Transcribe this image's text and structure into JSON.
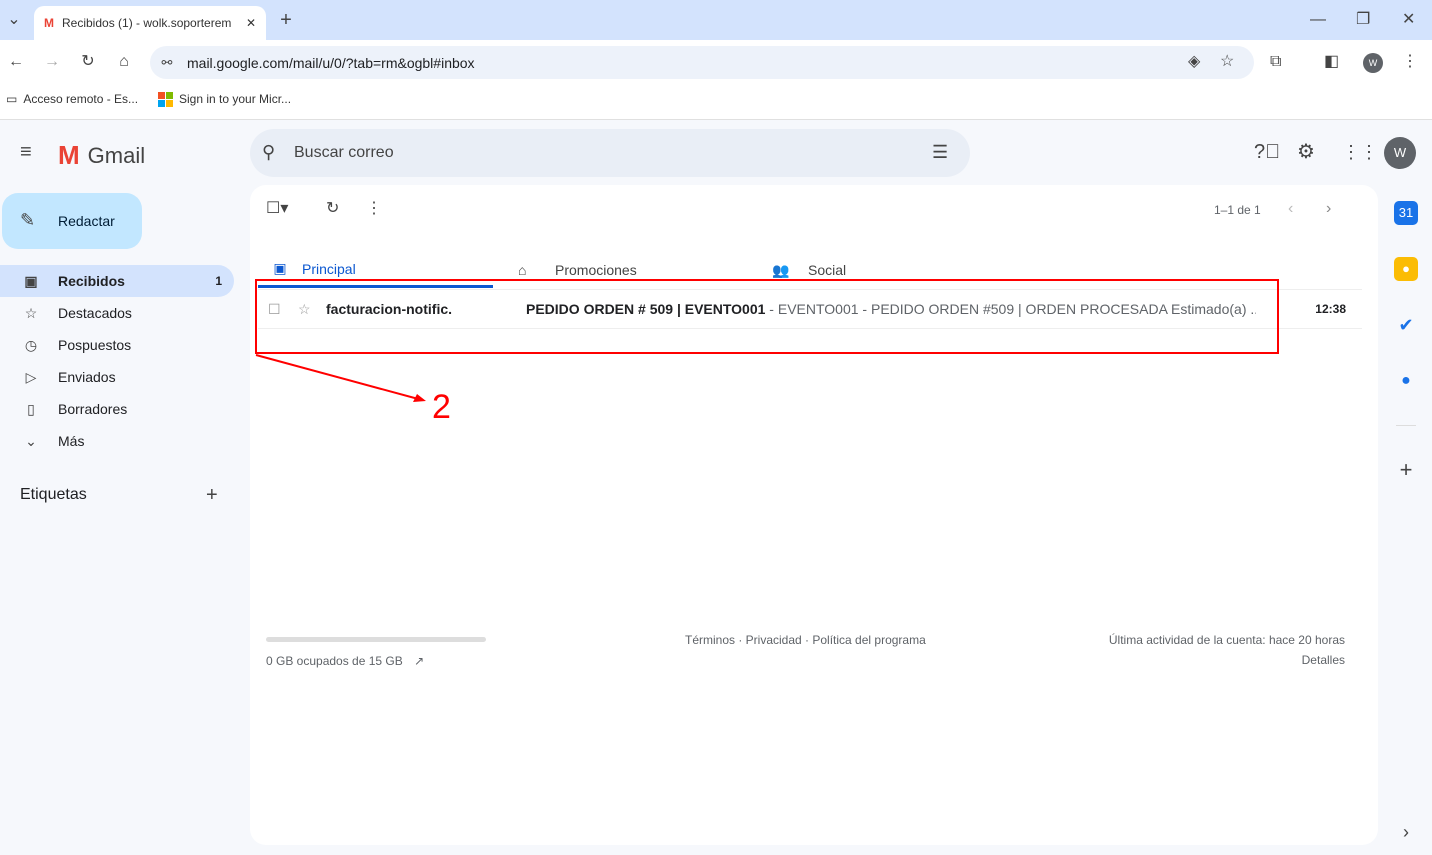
{
  "browser": {
    "tab_title": "Recibidos (1) - wolk.soporterem",
    "url": "mail.google.com/mail/u/0/?tab=rm&ogbl#inbox",
    "profile_initial": "W",
    "bookmarks": [
      {
        "label": "Acceso remoto - Es..."
      },
      {
        "label": "Sign in to your Micr..."
      }
    ]
  },
  "gmail": {
    "brand": "Gmail",
    "search_placeholder": "Buscar correo",
    "avatar": "W",
    "compose": "Redactar",
    "nav": [
      {
        "label": "Recibidos",
        "count": "1",
        "icon": "inbox-icon"
      },
      {
        "label": "Destacados",
        "icon": "star-icon"
      },
      {
        "label": "Pospuestos",
        "icon": "clock-icon"
      },
      {
        "label": "Enviados",
        "icon": "send-icon"
      },
      {
        "label": "Borradores",
        "icon": "draft-icon"
      },
      {
        "label": "Más",
        "icon": "chevron-down-icon"
      }
    ],
    "labels_title": "Etiquetas",
    "pagination": "1–1 de 1",
    "tabs": [
      {
        "label": "Principal",
        "active": true
      },
      {
        "label": "Promociones"
      },
      {
        "label": "Social"
      }
    ],
    "emails": [
      {
        "sender": "facturacion-notific.",
        "subject": "PEDIDO ORDEN # 509 | EVENTO001",
        "snippet": " - EVENTO001 - PEDIDO ORDEN #509 | ORDEN PROCESADA Estimado(a) ...",
        "time": "12:38"
      }
    ],
    "storage": "0 GB ocupados de 15 GB",
    "storage_percent": 0,
    "footer_links": "Términos · Privacidad · Política del programa",
    "activity": "Última actividad de la cuenta: hace 20 horas",
    "details": "Detalles"
  },
  "annotation": {
    "label": "2",
    "color": "#ff0000"
  },
  "colors": {
    "accent": "#0b57d0",
    "compose": "#c2e7ff",
    "selected_nav": "#d3e3fd"
  }
}
